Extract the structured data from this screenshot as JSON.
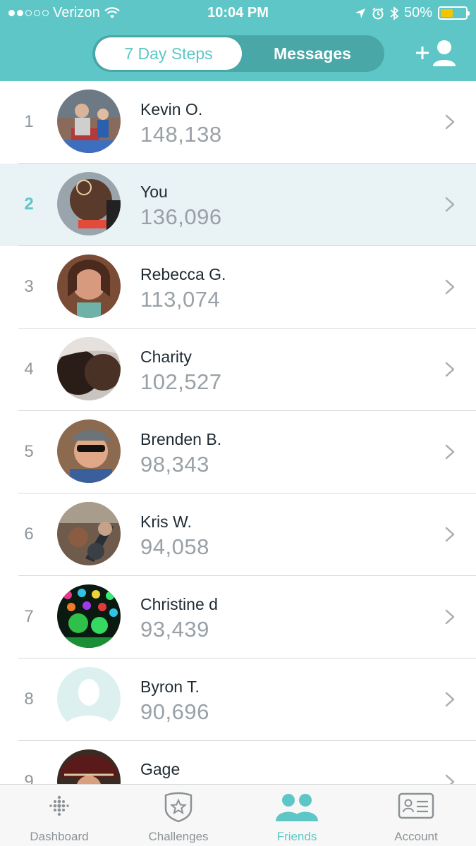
{
  "status_bar": {
    "carrier": "Verizon",
    "time": "10:04 PM",
    "battery": "50%",
    "battery_level": 0.5
  },
  "header": {
    "tabs": [
      {
        "label": "7 Day Steps",
        "active": true
      },
      {
        "label": "Messages",
        "active": false
      }
    ],
    "add_friend_icon": "add-friend-icon"
  },
  "leaderboard": [
    {
      "rank": "1",
      "name": "Kevin O.",
      "steps": "148,138",
      "highlight": false
    },
    {
      "rank": "2",
      "name": "You",
      "steps": "136,096",
      "highlight": true
    },
    {
      "rank": "3",
      "name": "Rebecca G.",
      "steps": "113,074",
      "highlight": false
    },
    {
      "rank": "4",
      "name": "Charity",
      "steps": "102,527",
      "highlight": false
    },
    {
      "rank": "5",
      "name": "Brenden B.",
      "steps": "98,343",
      "highlight": false
    },
    {
      "rank": "6",
      "name": "Kris W.",
      "steps": "94,058",
      "highlight": false
    },
    {
      "rank": "7",
      "name": "Christine d",
      "steps": "93,439",
      "highlight": false
    },
    {
      "rank": "8",
      "name": "Byron T.",
      "steps": "90,696",
      "highlight": false
    },
    {
      "rank": "9",
      "name": "Gage",
      "steps": "",
      "highlight": false
    }
  ],
  "tabbar": [
    {
      "label": "Dashboard",
      "icon": "dashboard-icon",
      "active": false
    },
    {
      "label": "Challenges",
      "icon": "challenges-icon",
      "active": false
    },
    {
      "label": "Friends",
      "icon": "friends-icon",
      "active": true
    },
    {
      "label": "Account",
      "icon": "account-icon",
      "active": false
    }
  ],
  "colors": {
    "accent": "#5ec6c6",
    "highlight_row": "#e9f3f5",
    "battery_fill": "#f5c400"
  }
}
